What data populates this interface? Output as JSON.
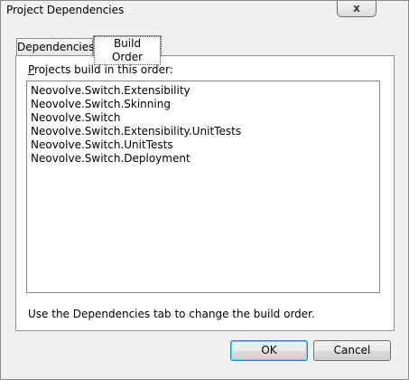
{
  "window": {
    "title": "Project Dependencies",
    "close_glyph": "x"
  },
  "tabs": [
    {
      "label": "Dependencies",
      "active": false
    },
    {
      "label": "Build Order",
      "active": true
    }
  ],
  "panel": {
    "label_accel": "P",
    "label_rest": "rojects build in this order:",
    "hint": "Use the Dependencies tab to change the build order."
  },
  "build_order": [
    "Neovolve.Switch.Extensibility",
    "Neovolve.Switch.Skinning",
    "Neovolve.Switch",
    "Neovolve.Switch.Extensibility.UnitTests",
    "Neovolve.Switch.UnitTests",
    "Neovolve.Switch.Deployment"
  ],
  "buttons": {
    "ok": "OK",
    "cancel": "Cancel"
  }
}
